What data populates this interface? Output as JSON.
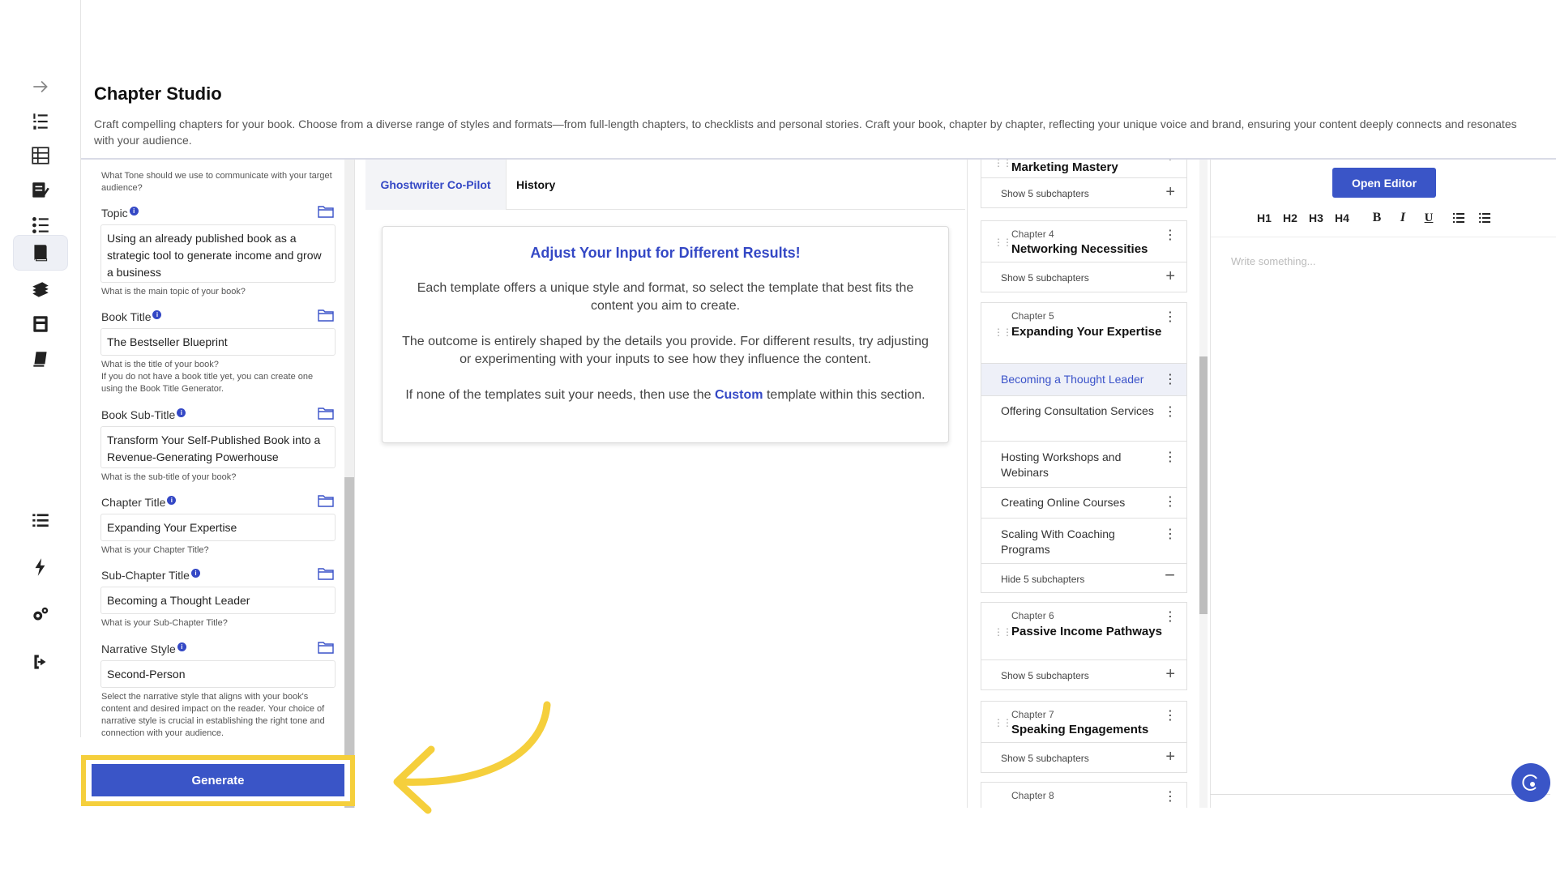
{
  "header": {
    "title": "Chapter Studio",
    "description": "Craft compelling chapters for your book. Choose from a diverse range of styles and formats—from full-length chapters, to checklists and personal stories. Craft your book, chapter by chapter, reflecting your unique voice and brand, ensuring your content deeply connects and resonates with your audience."
  },
  "rail": [
    "arrow-right-icon",
    "numbered-list-icon",
    "table-icon",
    "edit-note-icon",
    "checklist-icon",
    "book-icon",
    "books-icon",
    "archive-icon",
    "bookmark-icon",
    "list-icon",
    "lightning-icon",
    "settings-icon",
    "logout-icon"
  ],
  "form": {
    "tone_hint": "What Tone should we use to communicate with your target audience?",
    "topic": {
      "label": "Topic",
      "value": "Using an already published book as a strategic tool to generate income and grow a business",
      "hint": "What is the main topic of your book?"
    },
    "book_title": {
      "label": "Book Title",
      "value": "The Bestseller Blueprint",
      "hint": "What is the title of your book?\nIf you do not have a book title yet, you can create one using the Book Title Generator."
    },
    "book_subtitle": {
      "label": "Book Sub-Title",
      "value": "Transform Your Self-Published Book into a Revenue-Generating Powerhouse",
      "hint": "What is the sub-title of your book?"
    },
    "chapter_title": {
      "label": "Chapter Title",
      "value": "Expanding Your Expertise",
      "hint": "What is your Chapter Title?"
    },
    "subchapter_title": {
      "label": "Sub-Chapter Title",
      "value": "Becoming a Thought Leader",
      "hint": "What is your Sub-Chapter Title?"
    },
    "narrative_style": {
      "label": "Narrative Style",
      "value": "Second-Person",
      "hint": "Select the narrative style that aligns with your book's content and desired impact on the reader. Your choice of narrative style is crucial in establishing the right tone and connection with your audience."
    },
    "generate_label": "Generate"
  },
  "middle": {
    "tab_copilot": "Ghostwriter Co-Pilot",
    "tab_history": "History",
    "card_heading": "Adjust Your Input for Different Results!",
    "card_p1": "Each template offers a unique style and format, so select the template that best fits the content you aim to create.",
    "card_p2": "The outcome is entirely shaped by the details you provide. For different results, try adjusting or experimenting with your inputs to see how they influence the content.",
    "card_p3_pre": "If none of the templates suit your needs, then use the",
    "card_p3_link": "Custom",
    "card_p3_post": "template within this section."
  },
  "chapters": {
    "ch3": {
      "title": "Marketing Mastery",
      "footer": "Show 5 subchapters"
    },
    "ch4": {
      "num": "Chapter 4",
      "title": "Networking Necessities",
      "footer": "Show 5 subchapters"
    },
    "ch5": {
      "num": "Chapter 5",
      "title": "Expanding Your Expertise",
      "subs": [
        "Becoming a Thought Leader",
        "Offering Consultation Services",
        "Hosting Workshops and Webinars",
        "Creating Online Courses",
        "Scaling With Coaching Programs"
      ],
      "footer": "Hide 5 subchapters"
    },
    "ch6": {
      "num": "Chapter 6",
      "title": "Passive Income Pathways",
      "footer": "Show 5 subchapters"
    },
    "ch7": {
      "num": "Chapter 7",
      "title": "Speaking Engagements",
      "footer": "Show 5 subchapters"
    },
    "ch8": {
      "num": "Chapter 8"
    }
  },
  "editor": {
    "open_label": "Open Editor",
    "h1": "H1",
    "h2": "H2",
    "h3": "H3",
    "h4": "H4",
    "bold": "B",
    "italic": "I",
    "underline": "U",
    "placeholder": "Write something..."
  },
  "colors": {
    "accent": "#3a55c7",
    "highlight": "#f5cf3c"
  }
}
